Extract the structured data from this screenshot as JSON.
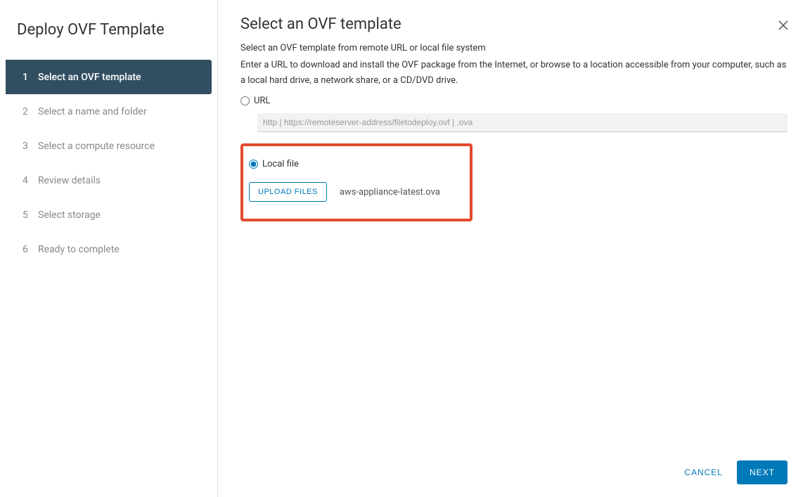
{
  "sidebar": {
    "title": "Deploy OVF Template",
    "steps": [
      {
        "num": "1",
        "label": "Select an OVF template"
      },
      {
        "num": "2",
        "label": "Select a name and folder"
      },
      {
        "num": "3",
        "label": "Select a compute resource"
      },
      {
        "num": "4",
        "label": "Review details"
      },
      {
        "num": "5",
        "label": "Select storage"
      },
      {
        "num": "6",
        "label": "Ready to complete"
      }
    ]
  },
  "main": {
    "title": "Select an OVF template",
    "subtitle": "Select an OVF template from remote URL or local file system",
    "description": "Enter a URL to download and install the OVF package from the Internet, or browse to a location accessible from your computer, such as a local hard drive, a network share, or a CD/DVD drive.",
    "url_label": "URL",
    "url_placeholder": "http | https://remoteserver-address/filetodeploy.ovf | .ova",
    "local_file_label": "Local file",
    "upload_button": "UPLOAD FILES",
    "selected_file": "aws-appliance-latest.ova"
  },
  "footer": {
    "cancel": "CANCEL",
    "next": "NEXT"
  }
}
